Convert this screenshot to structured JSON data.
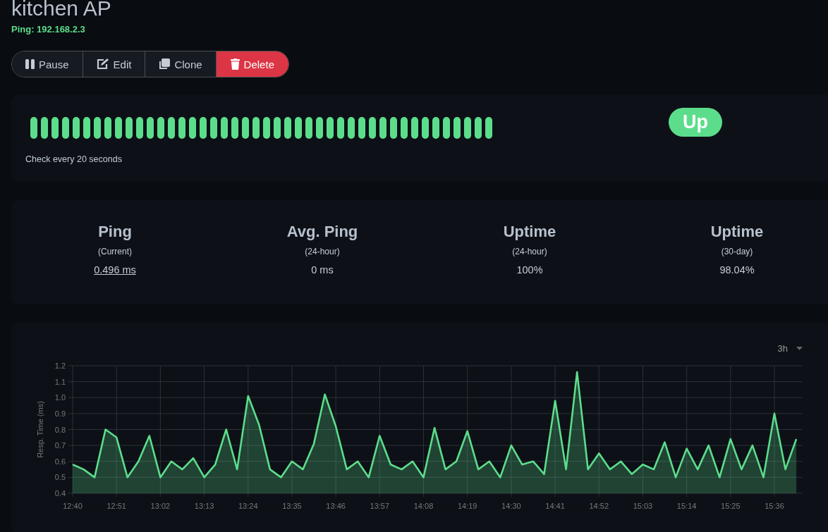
{
  "monitor": {
    "title": "kitchen AP",
    "subtitle": "Ping: 192.168.2.3"
  },
  "actions": [
    {
      "label": "Pause",
      "kind": "pause"
    },
    {
      "label": "Edit",
      "kind": "edit"
    },
    {
      "label": "Clone",
      "kind": "clone"
    },
    {
      "label": "Delete",
      "kind": "delete"
    }
  ],
  "heartbeat": {
    "beats": [
      {
        "up": true
      },
      {
        "up": true
      },
      {
        "up": true
      },
      {
        "up": true
      },
      {
        "up": true
      },
      {
        "up": true
      },
      {
        "up": true
      },
      {
        "up": true
      },
      {
        "up": true
      },
      {
        "up": true
      },
      {
        "up": true
      },
      {
        "up": true
      },
      {
        "up": true
      },
      {
        "up": true
      },
      {
        "up": true
      },
      {
        "up": true
      },
      {
        "up": true
      },
      {
        "up": true
      },
      {
        "up": true
      },
      {
        "up": true
      },
      {
        "up": true
      },
      {
        "up": true
      },
      {
        "up": true
      },
      {
        "up": true
      },
      {
        "up": true
      },
      {
        "up": true
      },
      {
        "up": true
      },
      {
        "up": true
      },
      {
        "up": true
      },
      {
        "up": true
      },
      {
        "up": true
      },
      {
        "up": true
      },
      {
        "up": true
      },
      {
        "up": true
      },
      {
        "up": true
      },
      {
        "up": true
      },
      {
        "up": true
      },
      {
        "up": true
      },
      {
        "up": true
      },
      {
        "up": true
      },
      {
        "up": true
      },
      {
        "up": true
      },
      {
        "up": true
      },
      {
        "up": true
      }
    ],
    "interval": "Check every 20 seconds",
    "status": {
      "label": "Up",
      "kind": "up"
    }
  },
  "stats": [
    {
      "title": "Ping",
      "period": "(Current)",
      "value": "0.496 ms",
      "link": true
    },
    {
      "title": "Avg. Ping",
      "period": "(24-hour)",
      "value": "0 ms",
      "link": false
    },
    {
      "title": "Uptime",
      "period": "(24-hour)",
      "value": "100%",
      "link": false
    },
    {
      "title": "Uptime",
      "period": "(30-day)",
      "value": "98.04%",
      "link": false
    }
  ],
  "chart": {
    "range": "3h",
    "chart_data": {
      "type": "area",
      "ylabel": "Resp. Time (ms)",
      "categories": [
        "12:40",
        null,
        null,
        null,
        "12:51",
        null,
        null,
        null,
        "13:02",
        null,
        null,
        null,
        "13:13",
        null,
        null,
        null,
        "13:24",
        null,
        null,
        null,
        "13:35",
        null,
        null,
        null,
        "13:46",
        null,
        null,
        null,
        "13:57",
        null,
        null,
        null,
        "14:08",
        null,
        null,
        null,
        "14:19",
        null,
        null,
        null,
        "14:30",
        null,
        null,
        null,
        "14:41",
        null,
        null,
        null,
        "14:52",
        null,
        null,
        null,
        "15:03",
        null,
        null,
        null,
        "15:14",
        null,
        null,
        null,
        "15:25",
        null,
        null,
        null,
        "15:36",
        null,
        null
      ],
      "grid": true,
      "series": [
        {
          "color": "#5cdd8b",
          "values": [
            0.58,
            0.55,
            0.5,
            0.8,
            0.75,
            0.5,
            0.6,
            0.76,
            0.5,
            0.6,
            0.55,
            0.62,
            0.5,
            0.58,
            0.8,
            0.55,
            1.01,
            0.83,
            0.55,
            0.5,
            0.6,
            0.55,
            0.71,
            1.02,
            0.82,
            0.55,
            0.6,
            0.5,
            0.76,
            0.58,
            0.55,
            0.6,
            0.5,
            0.81,
            0.55,
            0.6,
            0.79,
            0.55,
            0.6,
            0.5,
            0.7,
            0.58,
            0.6,
            0.52,
            0.98,
            0.55,
            1.16,
            0.55,
            0.65,
            0.55,
            0.6,
            0.52,
            0.58,
            0.55,
            0.72,
            0.5,
            0.68,
            0.55,
            0.7,
            0.5,
            0.74,
            0.55,
            0.7,
            0.5,
            0.9,
            0.55,
            0.74
          ]
        }
      ],
      "ylim": [
        0.4,
        1.2
      ],
      "yticks": [
        {
          "value": 0.4,
          "label": "0.4"
        },
        {
          "value": 0.5,
          "label": "0.5"
        },
        {
          "value": 0.6,
          "label": "0.6"
        },
        {
          "value": 0.7,
          "label": "0.7"
        },
        {
          "value": 0.8,
          "label": "0.8"
        },
        {
          "value": 0.9,
          "label": "0.9"
        },
        {
          "value": 1.0,
          "label": "1.0"
        },
        {
          "value": 1.1,
          "label": "1.1"
        },
        {
          "value": 1.2,
          "label": "1.2"
        }
      ]
    }
  }
}
